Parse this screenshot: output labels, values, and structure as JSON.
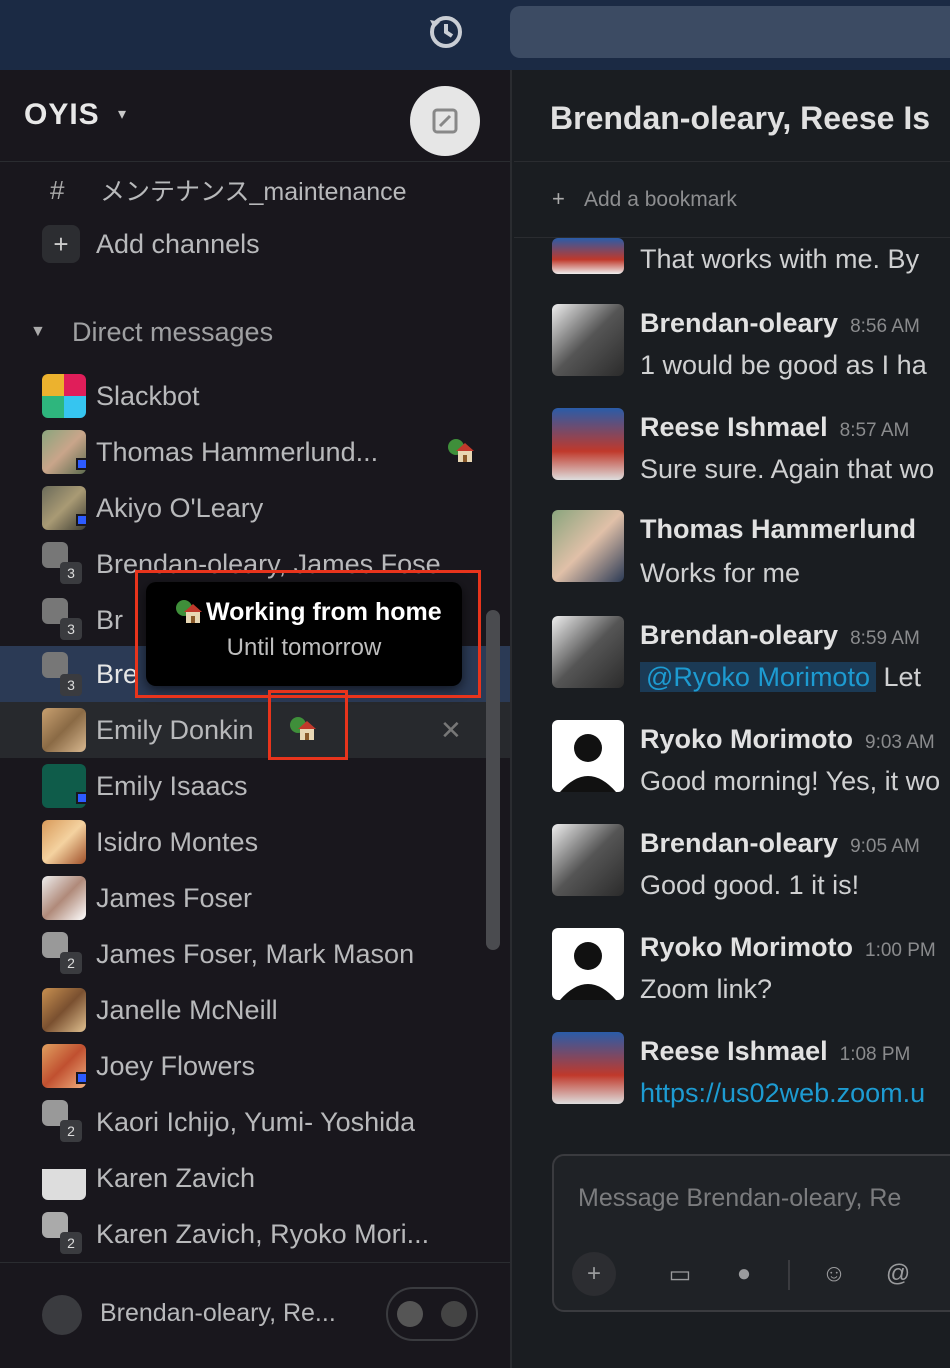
{
  "workspace": {
    "name": "OYIS"
  },
  "sidebar": {
    "channels": [
      {
        "name": "メンテナンス_maintenance"
      }
    ],
    "add_channels": "Add channels",
    "dm_section": "Direct messages",
    "dms": [
      {
        "name": "Slackbot"
      },
      {
        "name": "Thomas Hammerlund..."
      },
      {
        "name": "Akiyo O'Leary"
      },
      {
        "name": "Brendan-oleary, James Fose",
        "count": "3"
      },
      {
        "name": "Br",
        "count": "3"
      },
      {
        "name": "Bre",
        "count": "3"
      },
      {
        "name": "Emily Donkin"
      },
      {
        "name": "Emily Isaacs"
      },
      {
        "name": "Isidro Montes"
      },
      {
        "name": "James Foser"
      },
      {
        "name": "James Foser, Mark Mason",
        "count": "2"
      },
      {
        "name": "Janelle McNeill"
      },
      {
        "name": "Joey Flowers"
      },
      {
        "name": "Kaori Ichijo, Yumi- Yoshida",
        "count": "2"
      },
      {
        "name": "Karen Zavich"
      },
      {
        "name": "Karen Zavich, Ryoko Mori...",
        "count": "2"
      }
    ],
    "footer_label": "Brendan-oleary, Re..."
  },
  "tooltip": {
    "title": "Working from home",
    "subtitle": "Until tomorrow"
  },
  "channel": {
    "title": "Brendan-oleary, Reese Is",
    "bookmark": "Add a bookmark"
  },
  "messages": [
    {
      "name": "",
      "time": "",
      "body": "That works with me. By"
    },
    {
      "name": "Brendan-oleary",
      "time": "8:56 AM",
      "body": "1 would be good as I ha"
    },
    {
      "name": "Reese Ishmael",
      "time": "8:57 AM",
      "body": "Sure sure. Again that wo"
    },
    {
      "name": "Thomas Hammerlund",
      "time": "",
      "body": "Works for me"
    },
    {
      "name": "Brendan-oleary",
      "time": "8:59 AM",
      "mention": "@Ryoko Morimoto",
      "body": "Let"
    },
    {
      "name": "Ryoko Morimoto",
      "time": "9:03 AM",
      "body": "Good morning! Yes, it wo"
    },
    {
      "name": "Brendan-oleary",
      "time": "9:05 AM",
      "body": "Good good. 1 it is!"
    },
    {
      "name": "Ryoko Morimoto",
      "time": "1:00 PM",
      "body": "Zoom link?"
    },
    {
      "name": "Reese Ishmael",
      "time": "1:08 PM",
      "link": "https://us02web.zoom.u"
    }
  ],
  "composer": {
    "placeholder": "Message Brendan-oleary, Re"
  },
  "colors": {
    "accent": "#1d9bd1",
    "highlight": "#e8341c",
    "presence": "#2d5bff"
  }
}
